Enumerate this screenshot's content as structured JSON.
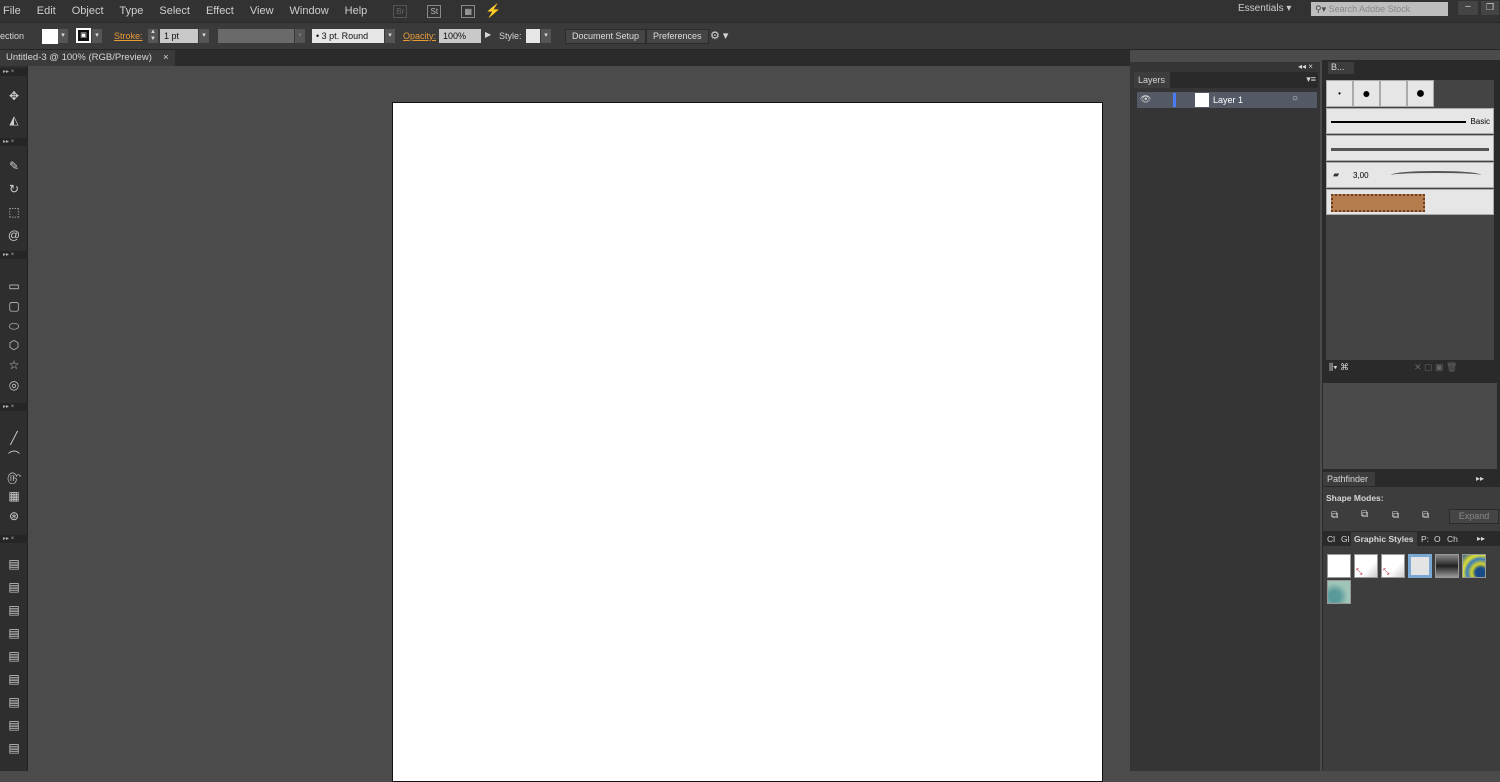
{
  "menu": [
    "File",
    "Edit",
    "Object",
    "Type",
    "Select",
    "Effect",
    "View",
    "Window",
    "Help"
  ],
  "menu_icons": {
    "bridge": "Br",
    "stock": "St"
  },
  "workspace": "Essentials",
  "search_placeholder": "Search Adobe Stock",
  "control": {
    "mode": "ection",
    "stroke_label": "Stroke:",
    "stroke_value": "1 pt",
    "brush": "3 pt. Round",
    "opacity_label": "Opacity:",
    "opacity_value": "100%",
    "style_label": "Style:",
    "document_setup": "Document Setup",
    "preferences": "Preferences"
  },
  "doc_tab": "Untitled-3 @ 100% (RGB/Preview)",
  "layers": {
    "tab": "Layers",
    "items": [
      "Layer 1"
    ]
  },
  "brushes": {
    "tab": "B...",
    "basic": "Basic",
    "size": "3,00"
  },
  "pathfinder": {
    "tab": "Pathfinder",
    "shape_modes": "Shape Modes:",
    "expand": "Expand"
  },
  "graphic_styles": {
    "tabs": [
      "Cl",
      "Gl",
      "Graphic Styles",
      "P:",
      "O",
      "Ch"
    ]
  },
  "colors": {
    "accent": "#e89a35",
    "layer_highlight": "#535a66"
  }
}
